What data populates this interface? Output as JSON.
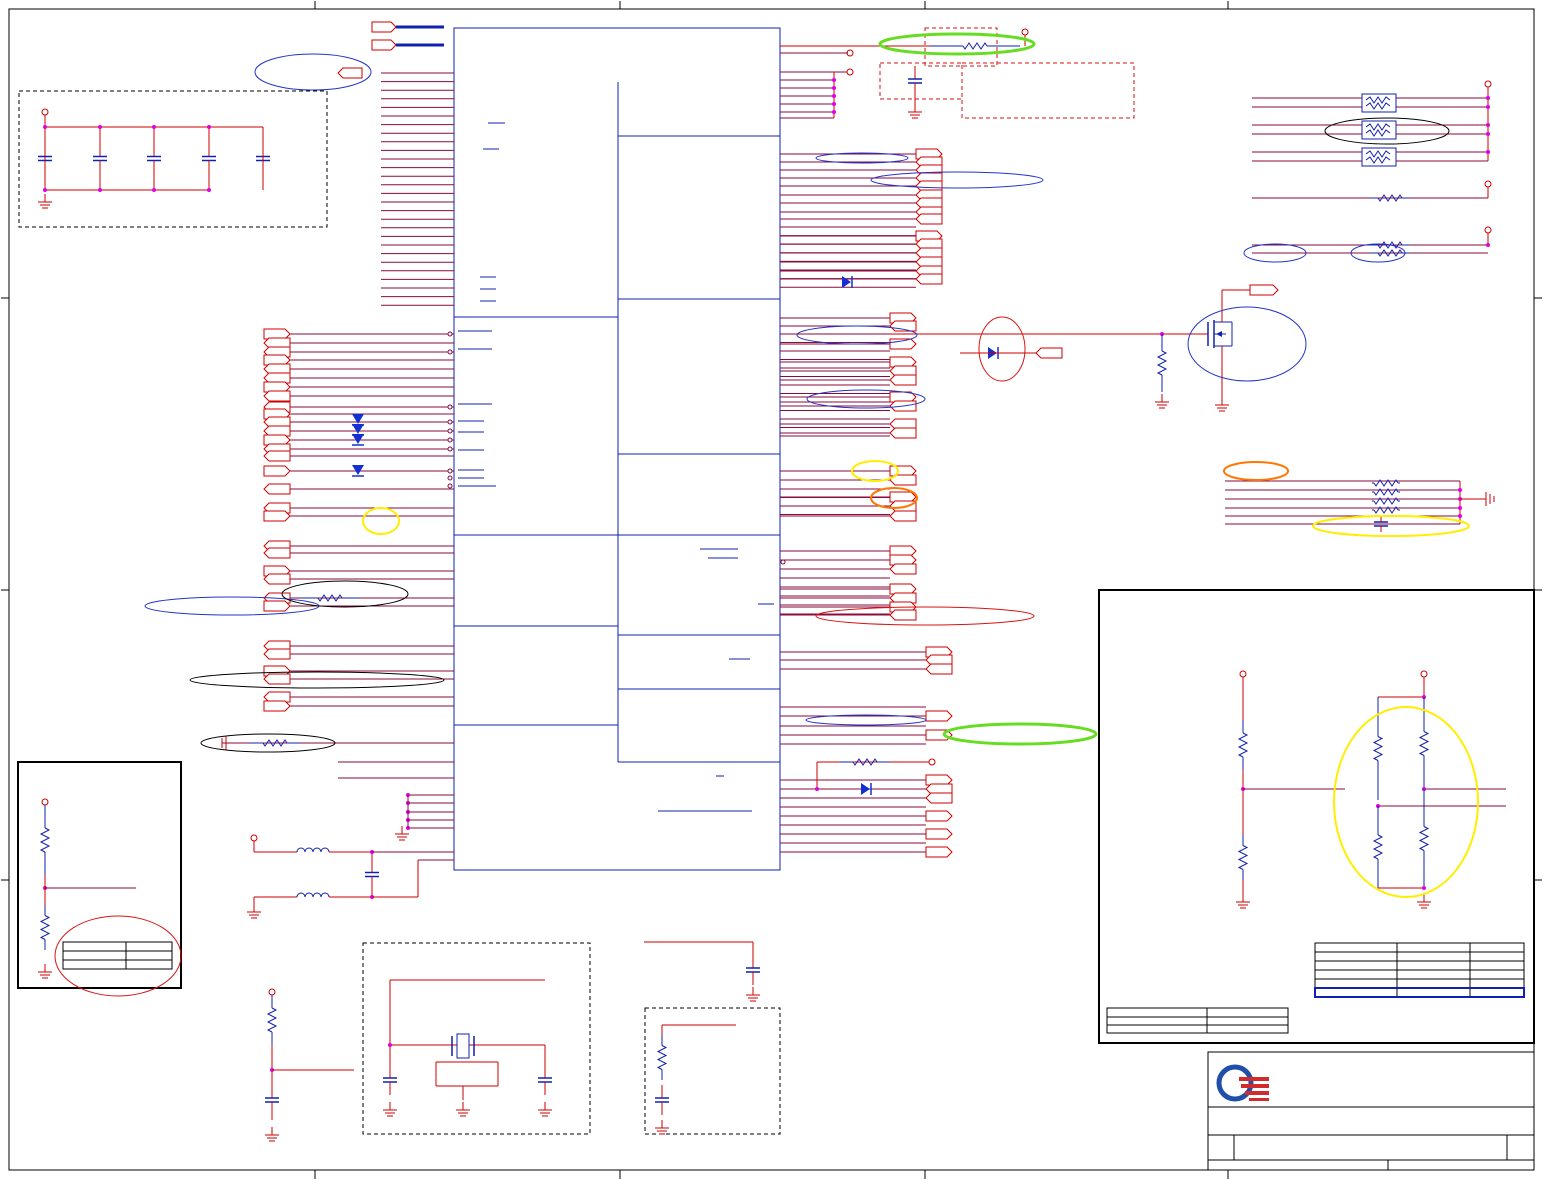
{
  "document": {
    "type": "schematic-sheet",
    "text_legible": false
  },
  "colors": {
    "wire": "#cc0000",
    "bus_pin": "#8b0a3c",
    "ic_outline": "#1020b0",
    "junction": "#e000e0",
    "frame": "#000000",
    "highlight_green": "#66dd22",
    "highlight_yellow": "#ffee00",
    "highlight_orange": "#ff7700",
    "highlight_blue": "#2233cc",
    "highlight_red": "#dd1111",
    "logo_blue": "#1f4fa8",
    "logo_red": "#d12b2b"
  },
  "icons": {
    "logo": "company-q-logo-icon",
    "ground": "ground-symbol-icon",
    "resistor": "resistor-icon",
    "capacitor": "capacitor-icon",
    "inductor": "inductor-icon",
    "diode": "diode-icon",
    "mosfet": "mosfet-icon",
    "crystal": "crystal-icon",
    "offpage_connector": "offpage-connector-icon"
  },
  "annotations": {
    "green_circles": 2,
    "yellow_circles": 4,
    "orange_circles": 2,
    "blue_circles": 10,
    "red_circles": 3,
    "black_circles": 4
  }
}
